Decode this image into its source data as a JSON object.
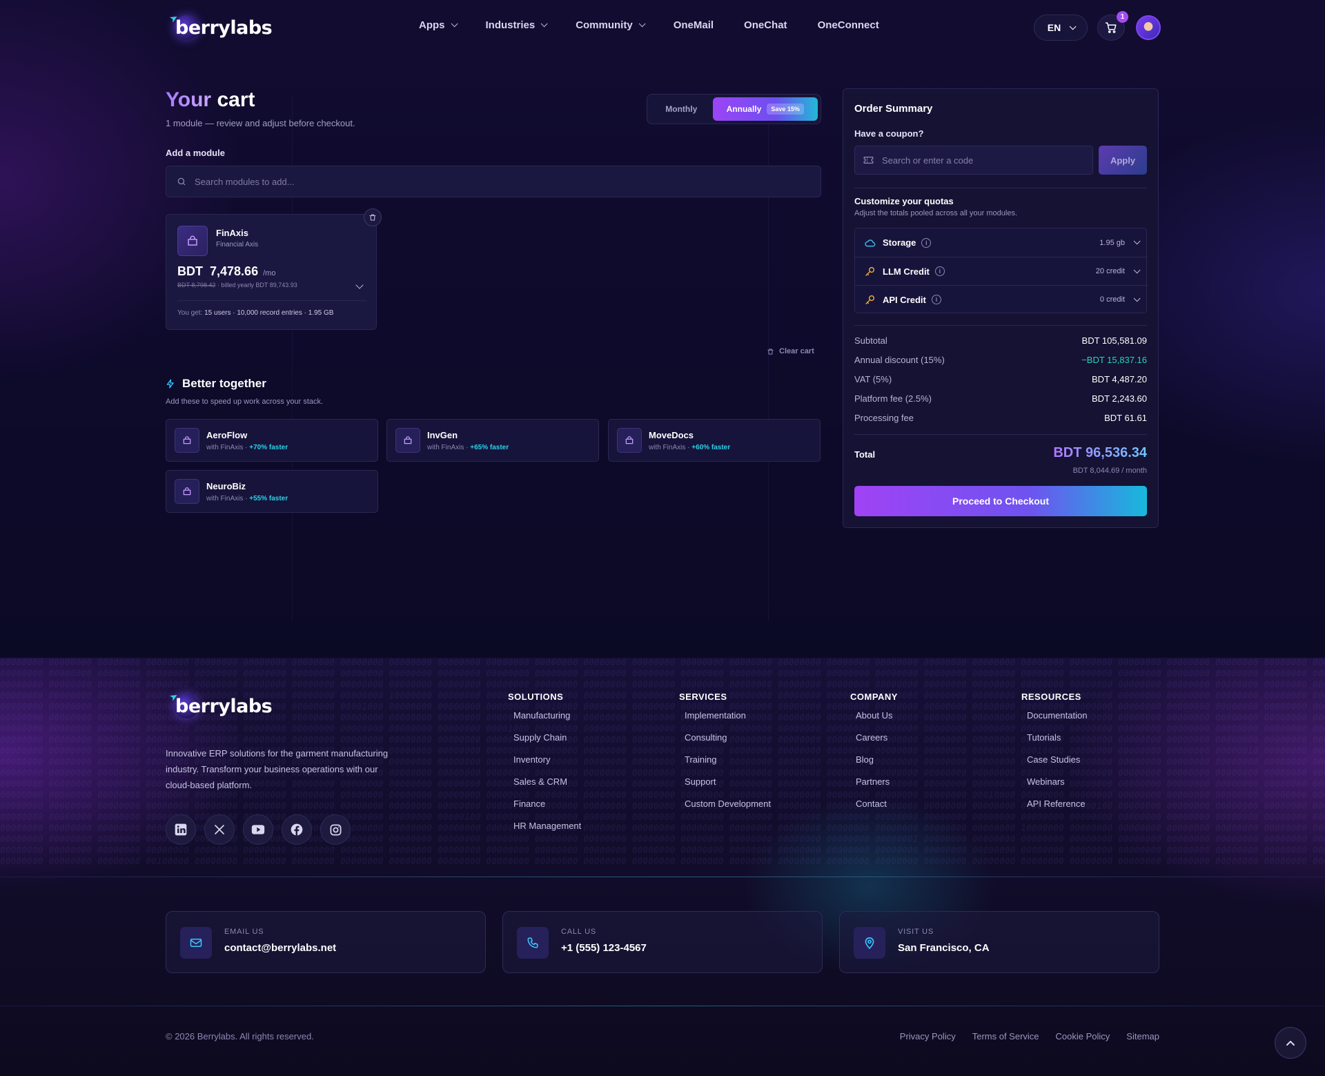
{
  "brand": {
    "name": "berrylabs"
  },
  "nav": {
    "links": [
      {
        "label": "Apps",
        "dropdown": true
      },
      {
        "label": "Industries",
        "dropdown": true
      },
      {
        "label": "Community",
        "dropdown": true
      },
      {
        "label": "OneMail",
        "dropdown": false
      },
      {
        "label": "OneChat",
        "dropdown": false
      },
      {
        "label": "OneConnect",
        "dropdown": false
      }
    ],
    "language": "EN",
    "cart_count": "1"
  },
  "cart": {
    "title_accent": "Your",
    "title_rest": "cart",
    "subtitle": "1 module — review and adjust before checkout.",
    "billing": {
      "monthly": "Monthly",
      "annually": "Annually",
      "save": "Save 15%",
      "selected": "annually"
    },
    "add_module_label": "Add a module",
    "search_placeholder": "Search modules to add...",
    "items": [
      {
        "name": "FinAxis",
        "subtitle": "Financial Axis",
        "currency": "BDT",
        "price": "7,478.66",
        "per": "/mo",
        "old_price": "BDT 8,798.42",
        "billed": "· billed yearly BDT 89,743.93",
        "gets_label": "You get:",
        "gets": "15 users · 10,000 record entries · 1.95 GB"
      }
    ],
    "clear_label": "Clear cart"
  },
  "better_together": {
    "title": "Better together",
    "subtitle": "Add these to speed up work across your stack.",
    "items": [
      {
        "name": "AeroFlow",
        "with": "with FinAxis ·",
        "boost": "+70% faster"
      },
      {
        "name": "InvGen",
        "with": "with FinAxis ·",
        "boost": "+65% faster"
      },
      {
        "name": "MoveDocs",
        "with": "with FinAxis ·",
        "boost": "+60% faster"
      },
      {
        "name": "NeuroBiz",
        "with": "with FinAxis ·",
        "boost": "+55% faster"
      }
    ]
  },
  "summary": {
    "title": "Order Summary",
    "coupon_label": "Have a coupon?",
    "coupon_placeholder": "Search or enter a code",
    "apply_label": "Apply",
    "quota_title": "Customize your quotas",
    "quota_sub": "Adjust the totals pooled across all your modules.",
    "quotas": [
      {
        "name": "Storage",
        "value": "1.95 gb",
        "icon": "cloud-icon",
        "color": "#3fb8ea"
      },
      {
        "name": "LLM Credit",
        "value": "20 credit",
        "icon": "key-icon",
        "color": "#e8a93a"
      },
      {
        "name": "API Credit",
        "value": "0 credit",
        "icon": "key-icon",
        "color": "#e8a93a"
      }
    ],
    "lines": [
      {
        "label": "Subtotal",
        "value": "BDT  105,581.09",
        "green": false
      },
      {
        "label": "Annual discount (15%)",
        "value": "−BDT  15,837.16",
        "green": true
      },
      {
        "label": "VAT (5%)",
        "value": "BDT  4,487.20",
        "green": false
      },
      {
        "label": "Platform fee (2.5%)",
        "value": "BDT  2,243.60",
        "green": false
      },
      {
        "label": "Processing fee",
        "value": "BDT  61.61",
        "green": false
      }
    ],
    "total_label": "Total",
    "total_value": "BDT  96,536.34",
    "total_monthly": "BDT  8,044.69 / month",
    "checkout_label": "Proceed to Checkout"
  },
  "footer": {
    "description": "Innovative ERP solutions for the garment manufacturing industry. Transform your business operations with our cloud-based platform.",
    "socials": [
      "linkedin-icon",
      "x-icon",
      "youtube-icon",
      "facebook-icon",
      "instagram-icon"
    ],
    "columns": [
      {
        "title": "SOLUTIONS",
        "links": [
          "Manufacturing",
          "Supply Chain",
          "Inventory",
          "Sales & CRM",
          "Finance",
          "HR Management"
        ]
      },
      {
        "title": "SERVICES",
        "links": [
          "Implementation",
          "Consulting",
          "Training",
          "Support",
          "Custom Development"
        ]
      },
      {
        "title": "COMPANY",
        "links": [
          "About Us",
          "Careers",
          "Blog",
          "Partners",
          "Contact"
        ]
      },
      {
        "title": "RESOURCES",
        "links": [
          "Documentation",
          "Tutorials",
          "Case Studies",
          "Webinars",
          "API Reference"
        ]
      }
    ],
    "contacts": [
      {
        "label": "EMAIL US",
        "value": "contact@berrylabs.net",
        "icon": "mail-icon"
      },
      {
        "label": "CALL US",
        "value": "+1 (555) 123-4567",
        "icon": "phone-icon"
      },
      {
        "label": "VISIT US",
        "value": "San Francisco, CA",
        "icon": "location-icon"
      }
    ],
    "copyright": "© 2026 Berrylabs. All rights reserved.",
    "legal": [
      "Privacy Policy",
      "Terms of Service",
      "Cookie Policy",
      "Sitemap"
    ]
  }
}
